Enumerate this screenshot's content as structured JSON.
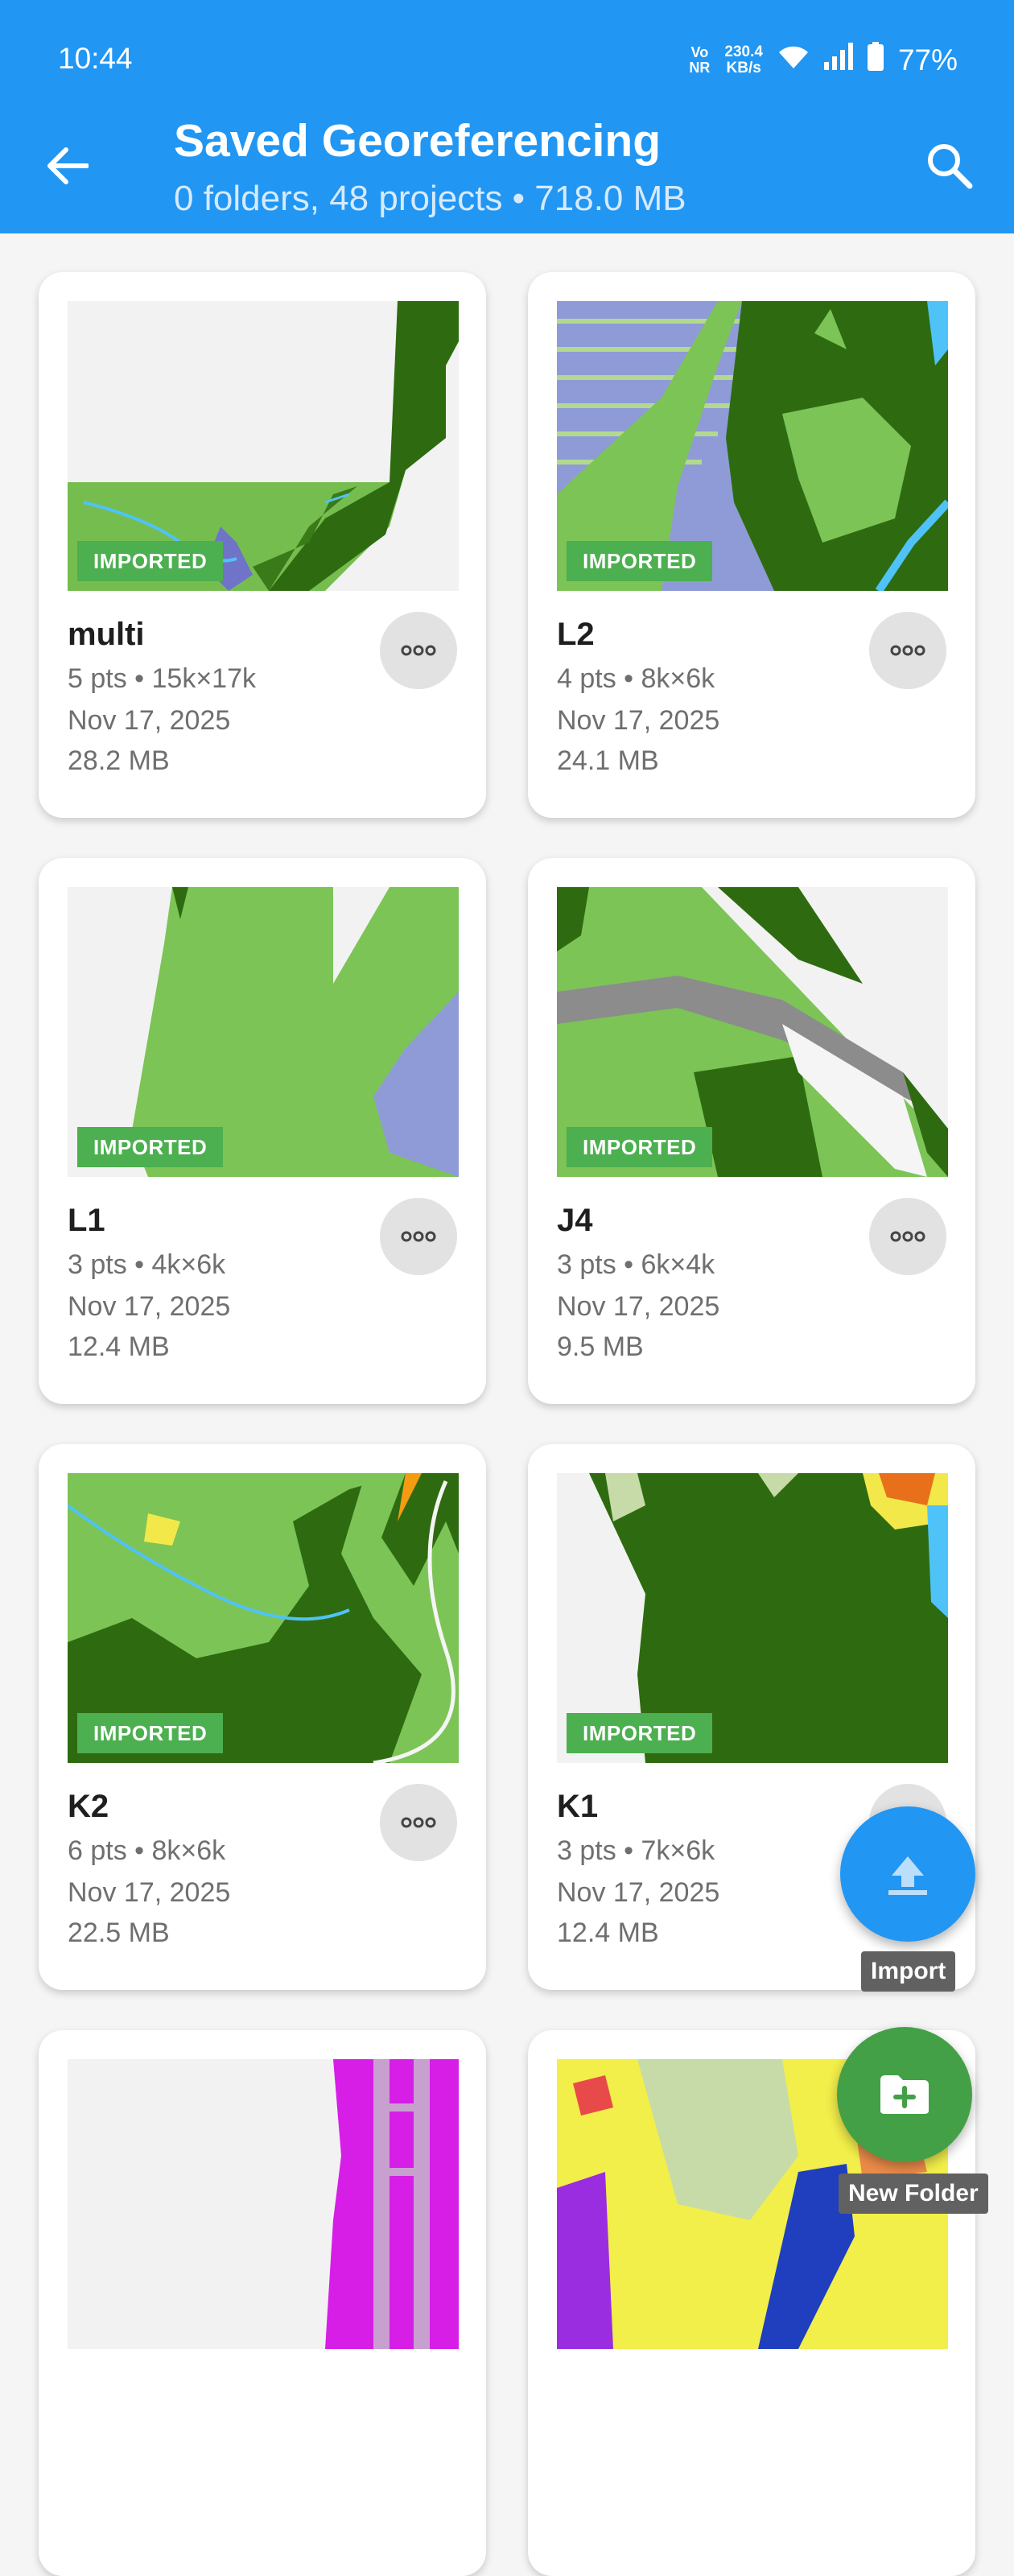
{
  "status_bar": {
    "time": "10:44",
    "volte": "Vo\nNR",
    "net_speed": "230.4\nKB/s",
    "battery": "77%"
  },
  "app_bar": {
    "title": "Saved Georeferencing",
    "subtitle": "0 folders, 48 projects • 718.0 MB",
    "back_icon": "arrow-back-icon",
    "search_icon": "search-icon"
  },
  "projects": [
    {
      "name": "multi",
      "badge": "IMPORTED",
      "pts": "5 pts • 15k×17k",
      "date": "Nov 17, 2025",
      "size": "28.2 MB"
    },
    {
      "name": "L2",
      "badge": "IMPORTED",
      "pts": "4 pts • 8k×6k",
      "date": "Nov 17, 2025",
      "size": "24.1 MB"
    },
    {
      "name": "L1",
      "badge": "IMPORTED",
      "pts": "3 pts • 4k×6k",
      "date": "Nov 17, 2025",
      "size": "12.4 MB"
    },
    {
      "name": "J4",
      "badge": "IMPORTED",
      "pts": "3 pts • 6k×4k",
      "date": "Nov 17, 2025",
      "size": "9.5 MB"
    },
    {
      "name": "K2",
      "badge": "IMPORTED",
      "pts": "6 pts • 8k×6k",
      "date": "Nov 17, 2025",
      "size": "22.5 MB"
    },
    {
      "name": "K1",
      "badge": "IMPORTED",
      "pts": "3 pts • 7k×6k",
      "date": "Nov 17, 2025",
      "size": "12.4 MB"
    }
  ],
  "fabs": {
    "import_label": "Import",
    "new_folder_label": "New Folder"
  },
  "colors": {
    "primary": "#2196f3",
    "badge": "#4caf50",
    "fab_folder": "#43a047"
  }
}
